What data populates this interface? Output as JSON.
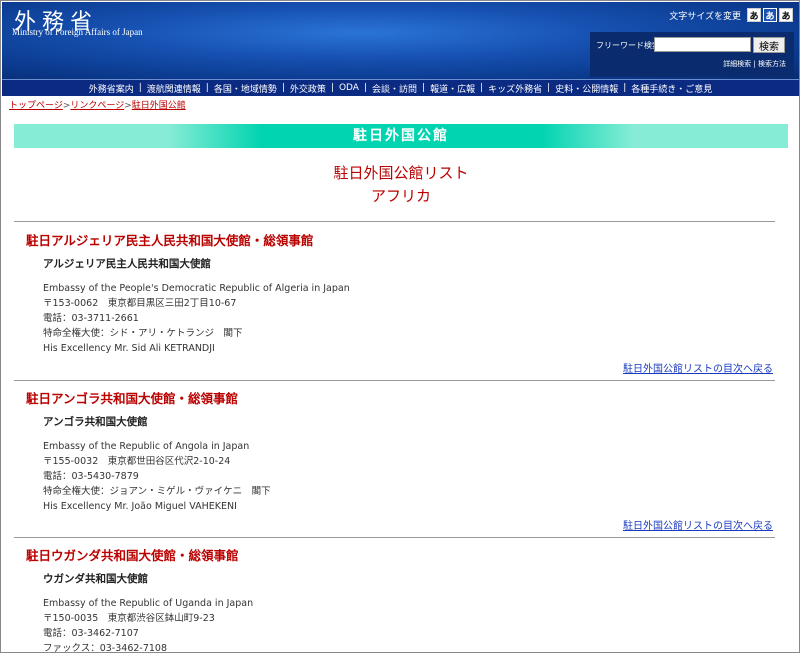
{
  "header": {
    "logo": "外務省",
    "logo_en": "Ministry of Foreign Affairs of Japan",
    "font_size_label": "文字サイズを変更",
    "font_sizes": [
      "あ",
      "あ",
      "あ"
    ],
    "search_label": "フリーワード検索",
    "search_value": "",
    "search_button": "検索",
    "advanced_search": "詳細検索",
    "search_help": "検索方法"
  },
  "nav": [
    "外務省案内",
    "渡航関連情報",
    "各国・地域情勢",
    "外交政策",
    "ODA",
    "会談・訪問",
    "報道・広報",
    "キッズ外務省",
    "史料・公開情報",
    "各種手続き・ご意見"
  ],
  "breadcrumb": [
    "トップページ",
    "リンクページ",
    "駐日外国公館"
  ],
  "band_title": "駐日外国公館",
  "page_title": "駐日外国公館リスト",
  "page_subtitle": "アフリカ",
  "back_link": "駐日外国公館リストの目次へ戻る",
  "sections": [
    {
      "title": "駐日アルジェリア民主人民共和国大使館・総領事館",
      "name": "アルジェリア民主人民共和国大使館",
      "lines": [
        "Embassy of the People's Democratic Republic of Algeria in Japan",
        "〒153-0062　東京都目黒区三田2丁目10-67",
        "電話：03-3711-2661",
        "特命全権大使：シド・アリ・ケトランジ　閣下",
        "His Excellency Mr. Sid Ali KETRANDJI"
      ]
    },
    {
      "title": "駐日アンゴラ共和国大使館・総領事館",
      "name": "アンゴラ共和国大使館",
      "lines": [
        "Embassy of the Republic of Angola in Japan",
        "〒155-0032　東京都世田谷区代沢2-10-24",
        "電話：03-5430-7879",
        "特命全権大使：ジョアン・ミゲル・ヴァイケニ　閣下",
        "His Excellency Mr. João Miguel VAHEKENI"
      ]
    },
    {
      "title": "駐日ウガンダ共和国大使館・総領事館",
      "name": "ウガンダ共和国大使館",
      "lines": [
        "Embassy of the Republic of Uganda in Japan",
        "〒150-0035　東京都渋谷区鉢山町9-23",
        "電話：03-3462-7107",
        "ファックス：03-3462-7108"
      ]
    }
  ]
}
